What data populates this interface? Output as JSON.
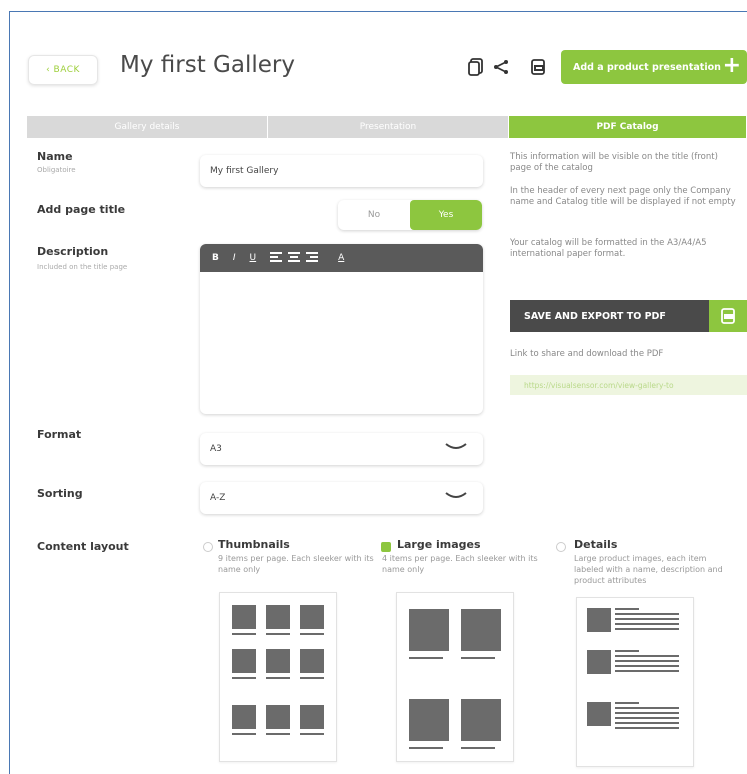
{
  "header": {
    "back_label": "‹ BACK",
    "title": "My first Gallery",
    "add_button_label": "Add a product presentation"
  },
  "tabs": [
    {
      "label": "Gallery details",
      "active": false
    },
    {
      "label": "Presentation",
      "active": false
    },
    {
      "label": "PDF Catalog",
      "active": true
    }
  ],
  "form": {
    "name_label": "Name",
    "name_sub": "Obligatoire",
    "name_value": "My first Gallery",
    "page_title_label": "Add page title",
    "toggle_no": "No",
    "toggle_yes": "Yes",
    "toggle_selected": "Yes",
    "description_label": "Description",
    "description_sub": "Included on the title page",
    "format_label": "Format",
    "format_value": "A3",
    "sorting_label": "Sorting",
    "sorting_value": "A-Z",
    "content_layout_label": "Content layout"
  },
  "toolbar": [
    "B",
    "I",
    "U",
    "align-left",
    "align-center",
    "align-right",
    "A"
  ],
  "info": {
    "line1": "This information will be visible on the title (front) page of the catalog",
    "line2": "In the header of every next page only the Company name and Catalog title will be displayed if not empty",
    "line3": "Your catalog will be formatted in the A3/A4/A5 international paper format.",
    "export_label": "SAVE AND EXPORT TO PDF",
    "link_label": "Link to share and download the PDF",
    "link_value": "https://visualsensor.com/view-gallery-to"
  },
  "layouts": [
    {
      "title": "Thumbnails",
      "desc": "9 items per page. Each sleeker with its name only",
      "selected": false
    },
    {
      "title": "Large images",
      "desc": "4 items per page. Each sleeker with its name only",
      "selected": true
    },
    {
      "title": "Details",
      "desc": "Large product images, each item labeled with a name, description and product attributes",
      "selected": false
    }
  ],
  "colors": {
    "accent": "#8dc63f",
    "dark": "#4a4a4a",
    "tab_inactive": "#d9d9d9"
  }
}
